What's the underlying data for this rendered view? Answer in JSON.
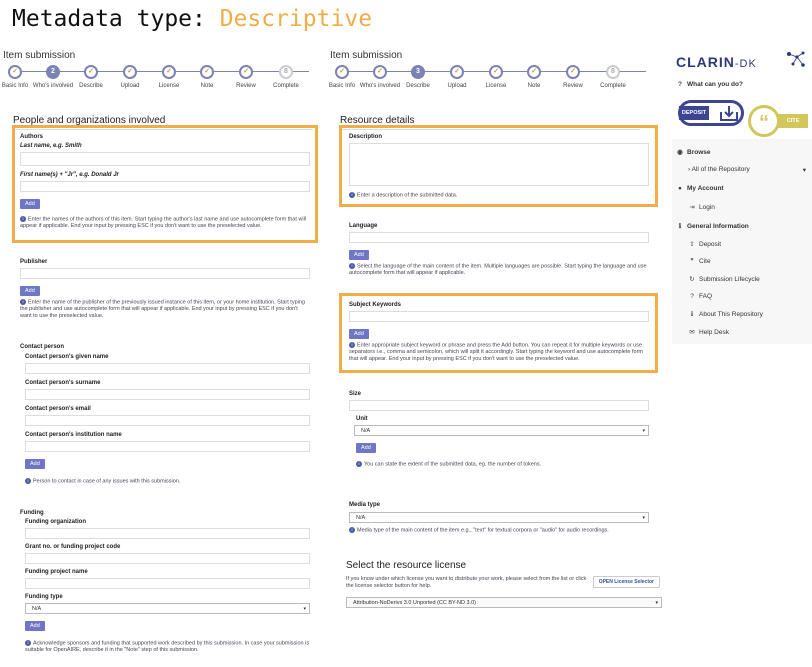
{
  "title": {
    "prefix": "Metadata type: ",
    "accent": "Descriptive"
  },
  "left": {
    "item_submission": "Item submission",
    "steps": [
      {
        "label": "Basic Info",
        "num": "1",
        "state": "done"
      },
      {
        "label": "Who's involved",
        "num": "2",
        "state": "current"
      },
      {
        "label": "Describe",
        "num": "3",
        "state": "done"
      },
      {
        "label": "Upload",
        "num": "4",
        "state": "done"
      },
      {
        "label": "License",
        "num": "5",
        "state": "done"
      },
      {
        "label": "Note",
        "num": "6",
        "state": "done"
      },
      {
        "label": "Review",
        "num": "7",
        "state": "done"
      },
      {
        "label": "Complete",
        "num": "8",
        "state": "future"
      }
    ],
    "section": "People and organizations involved",
    "authors": "Authors",
    "last_name": "Last name, e.g. Smith",
    "first_name": "First name(s) + \"Jr\", e.g. Donald Jr",
    "add": "Add",
    "authors_help": "Enter the names of the authors of this item. Start typing the author's last name and use autocomplete form that will appear if applicable. End your input by pressing ESC if you don't want to use the preselected value.",
    "publisher": "Publisher",
    "publisher_help": "Enter the name of the publisher of the previously issued instance of this item, or your home institution. Start typing the publisher and use autocomplete form that will appear if applicable. End your input by pressing ESC if you don't want to use the preselected value.",
    "contact_person": "Contact person",
    "given_name": "Contact person's given name",
    "surname": "Contact person's surname",
    "email": "Contact person's email",
    "institution": "Contact person's institution name",
    "contact_help": "Person to contact in case of any issues with this submission.",
    "funding": "Funding",
    "funding_org": "Funding organization",
    "grant": "Grant no. or funding project code",
    "funding_project": "Funding project name",
    "funding_type": "Funding type",
    "funding_type_value": "N/A",
    "funding_help": "Acknowledge sponsors and funding that supported work described by this submission. In case your submission is suitable for OpenAIRE, describe it in the \"Note\" step of this submission."
  },
  "right": {
    "item_submission": "Item submission",
    "steps": [
      {
        "label": "Basic Info",
        "num": "1",
        "state": "done"
      },
      {
        "label": "Who's involved",
        "num": "2",
        "state": "done"
      },
      {
        "label": "Describe",
        "num": "3",
        "state": "current"
      },
      {
        "label": "Upload",
        "num": "4",
        "state": "done"
      },
      {
        "label": "License",
        "num": "5",
        "state": "done"
      },
      {
        "label": "Note",
        "num": "6",
        "state": "done"
      },
      {
        "label": "Review",
        "num": "7",
        "state": "done"
      },
      {
        "label": "Complete",
        "num": "8",
        "state": "future"
      }
    ],
    "section": "Resource details",
    "description": "Description",
    "description_help": "Enter a description of the submitted data.",
    "language": "Language",
    "add": "Add",
    "language_help": "Select the language of the main content of the item. Multiple languages are possible. Start typing the language and use autocomplete form that will appear if applicable.",
    "keywords": "Subject Keywords",
    "keywords_help": "Enter appropriate subject keyword or phrase and press the Add button. You can repeat it for multiple keywords or use separators i.e., comma and semicolon, which will split it accordingly. Start typing the keyword and use autocomplete form that will appear. End your input by pressing ESC if you don't want to use the preselected value.",
    "size": "Size",
    "unit": "Unit",
    "unit_value": "N/A",
    "size_help": "You can state the extent of the submitted data, eg. the number of tokens.",
    "media_type": "Media type",
    "media_value": "N/A",
    "media_help": "Media type of the main content of the item e.g., \"text\" for textual corpora or \"audio\" for audio recordings.",
    "license_title": "Select the resource license",
    "license_text": "If you know under which license you want to distribute your work, please select from the list or click the license selector button for help.",
    "license_selector": "OPEN License Selector",
    "license_value": "Attribution-NoDerivs 3.0 Unported (CC BY-ND 3.0)"
  },
  "sidebar": {
    "logo": "CLARIN",
    "logo_suffix": "-DK",
    "what": "What can you do?",
    "deposit_badge": "DEPOSIT",
    "cite_badge": "CITE",
    "browse": "Browse",
    "all_repo": "All of the Repository",
    "my_account": "My Account",
    "login": "Login",
    "general": "General Information",
    "deposit": "Deposit",
    "cite": "Cite",
    "lifecycle": "Submission Lifecycle",
    "faq": "FAQ",
    "about": "About This Repository",
    "help": "Help Desk"
  },
  "colors": {
    "accent": "#f2ac48",
    "primary": "#6f77c4"
  }
}
